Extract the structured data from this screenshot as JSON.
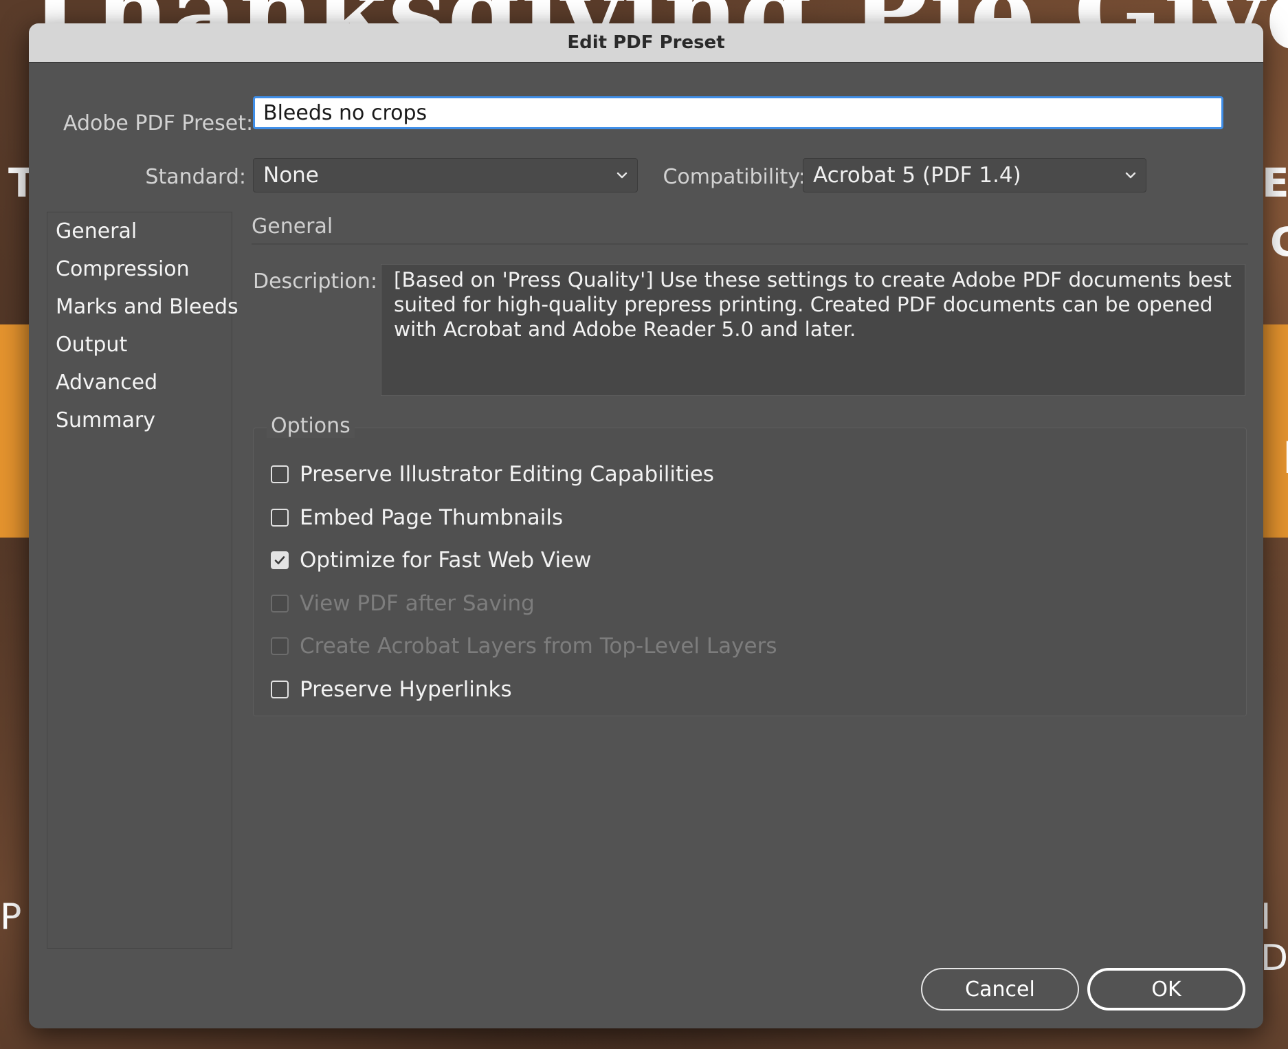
{
  "background": {
    "title_fragment": "Thanksgiving Pie Giveaw",
    "fragments": [
      "T",
      "E",
      "G",
      "|",
      "P",
      "I D"
    ],
    "band_color": "#e4932e"
  },
  "dialog": {
    "title": "Edit PDF Preset"
  },
  "preset": {
    "label": "Adobe PDF Preset:",
    "value": "Bleeds no crops"
  },
  "standard": {
    "label": "Standard:",
    "value": "None"
  },
  "compatibility": {
    "label": "Compatibility:",
    "value": "Acrobat 5 (PDF 1.4)"
  },
  "sidebar": {
    "items": [
      {
        "label": "General"
      },
      {
        "label": "Compression"
      },
      {
        "label": "Marks and Bleeds"
      },
      {
        "label": "Output"
      },
      {
        "label": "Advanced"
      },
      {
        "label": "Summary"
      }
    ]
  },
  "section": {
    "title": "General"
  },
  "description": {
    "label": "Description:",
    "text": "[Based on 'Press Quality'] Use these settings to create Adobe PDF documents best suited for high-quality prepress printing.  Created PDF documents can be opened with Acrobat and Adobe Reader 5.0 and later."
  },
  "options": {
    "legend": "Options",
    "items": [
      {
        "label": "Preserve Illustrator Editing Capabilities",
        "checked": false,
        "disabled": false
      },
      {
        "label": "Embed Page Thumbnails",
        "checked": false,
        "disabled": false
      },
      {
        "label": "Optimize for Fast Web View",
        "checked": true,
        "disabled": false
      },
      {
        "label": "View PDF after Saving",
        "checked": false,
        "disabled": true
      },
      {
        "label": "Create Acrobat Layers from Top-Level Layers",
        "checked": false,
        "disabled": true
      },
      {
        "label": "Preserve Hyperlinks",
        "checked": false,
        "disabled": false
      }
    ]
  },
  "buttons": {
    "cancel": "Cancel",
    "ok": "OK"
  },
  "icons": {
    "dropdown": "chevron-down-icon",
    "check": "checkmark-icon"
  },
  "colors": {
    "accent": "#3f8ee8",
    "dialog_bg": "#535353",
    "titlebar_bg": "#d6d6d6"
  }
}
